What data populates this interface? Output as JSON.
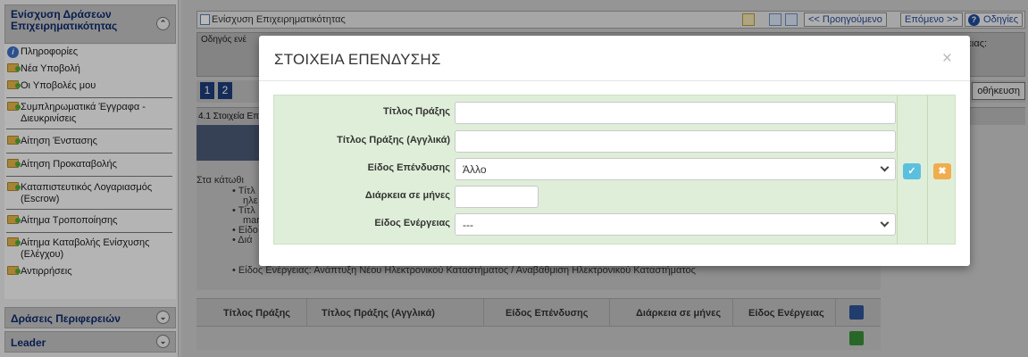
{
  "sidebar": {
    "section_title": "Ενίσχυση Δράσεων Επιχειρηματικότητας",
    "items": [
      {
        "label": "Πληροφορίες",
        "icon": "info-icon"
      },
      {
        "label": "Νέα Υποβολή",
        "icon": "folder-icon"
      },
      {
        "label": "Οι Υποβολές μου",
        "icon": "folder-icon"
      },
      {
        "label": "Συμπληρωματικά Έγγραφα - Διευκρινίσεις",
        "icon": "folder-icon"
      },
      {
        "label": "Αίτηση Ένστασης",
        "icon": "folder-icon"
      },
      {
        "label": "Αίτηση Προκαταβολής",
        "icon": "folder-icon"
      },
      {
        "label": "Καταπιστευτικός Λογαριασμός (Escrow)",
        "icon": "folder-icon"
      },
      {
        "label": "Αίτημα Τροποποίησης",
        "icon": "folder-icon"
      },
      {
        "label": "Αίτημα Καταβολής Ενίσχυσης (Ελέγχου)",
        "icon": "folder-icon"
      },
      {
        "label": "Αντιρρήσεις",
        "icon": "folder-icon"
      }
    ],
    "section2_title": "Δράσεις Περιφερειών",
    "section3_title": "Leader"
  },
  "topbar": {
    "title": "Ενίσχυση Επιχειρηματικότητας",
    "prev_label": "<< Προηγούμενο",
    "next_label": "Επόμενο >>",
    "help_label": "Οδηγίες"
  },
  "guide": {
    "prefix": "Οδηγός ενέ",
    "right_label": "ειας:"
  },
  "steps": [
    "1",
    "2"
  ],
  "save_label": "οθήκευση",
  "section_title": "4.1 Στοιχεία Επ",
  "body_lines": [
    "Στα κάτωθι",
    "• Τίτλ",
    "ηλε",
    "• Τίτλ",
    "mar",
    "• Είδο",
    "• Διά",
    "• Είδος Ενέργειας: Ανάπτυξη Νέου Ηλεκτρονικού Καταστήματος / Αναβάθμιση Ηλεκτρονικού Καταστήματος"
  ],
  "grid": {
    "columns": [
      "Τίτλος Πράξης",
      "Τίτλος Πράξης (Αγγλικά)",
      "Είδος Επένδυσης",
      "Διάρκεια σε μήνες",
      "Είδος Ενέργειας"
    ]
  },
  "modal": {
    "title": "ΣΤΟΙΧΕΙΑ ΕΠΕΝΔΥΣΗΣ",
    "close": "×",
    "fields": {
      "title_label": "Τίτλος Πράξης",
      "title_value": "",
      "title_en_label": "Τίτλος Πράξης (Αγγλικά)",
      "title_en_value": "",
      "investment_type_label": "Είδος Επένδυσης",
      "investment_type_value": "Άλλο",
      "duration_label": "Διάρκεια σε μήνες",
      "duration_value": "",
      "action_type_label": "Είδος Ενέργειας",
      "action_type_value": "---"
    },
    "colors": {
      "accept": "#5bc0de",
      "cancel": "#f0ad4e",
      "panel": "#dfeed8"
    }
  }
}
